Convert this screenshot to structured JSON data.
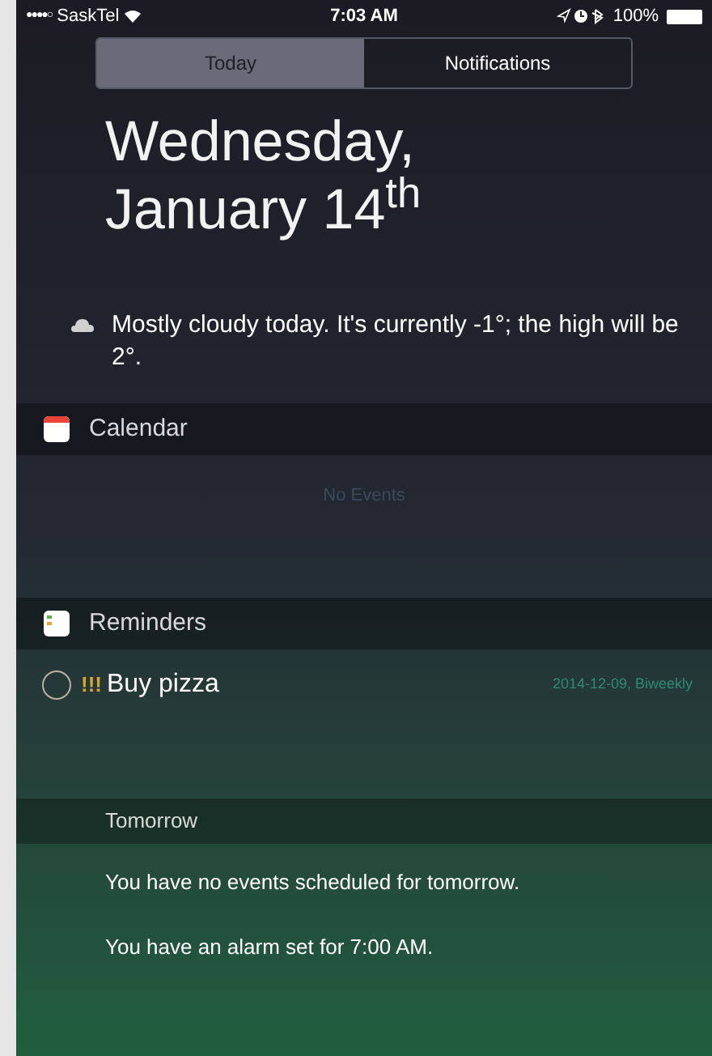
{
  "status_bar": {
    "carrier": "SaskTel",
    "signal_dots": "●●●●○",
    "time": "7:03 AM",
    "battery": "100%"
  },
  "tabs": [
    {
      "label": "Today",
      "selected": true
    },
    {
      "label": "Notifications",
      "selected": false
    }
  ],
  "date": {
    "line_1": "Wednesday,",
    "line_2": "January 14$^{th}$"
  },
  "weather": "Mostly cloudy today. It's currently -1°; the high will be 2°.",
  "sections": [
    {
      "kind": "calendar",
      "title": "Calendar",
      "empty_text": "No Events"
    },
    {
      "kind": "reminders",
      "title": "Reminders",
      "items": [
        {
          "priority": "!!!",
          "title": "Buy pizza",
          "due": "2014-12-09, Biweekly",
          "checked": false
        }
      ]
    }
  ],
  "tomorrow": {
    "title": "Tomorrow",
    "lines": [
      "You have no events scheduled for tomorrow.",
      "You have an alarm set for 7:00 AM."
    ]
  }
}
